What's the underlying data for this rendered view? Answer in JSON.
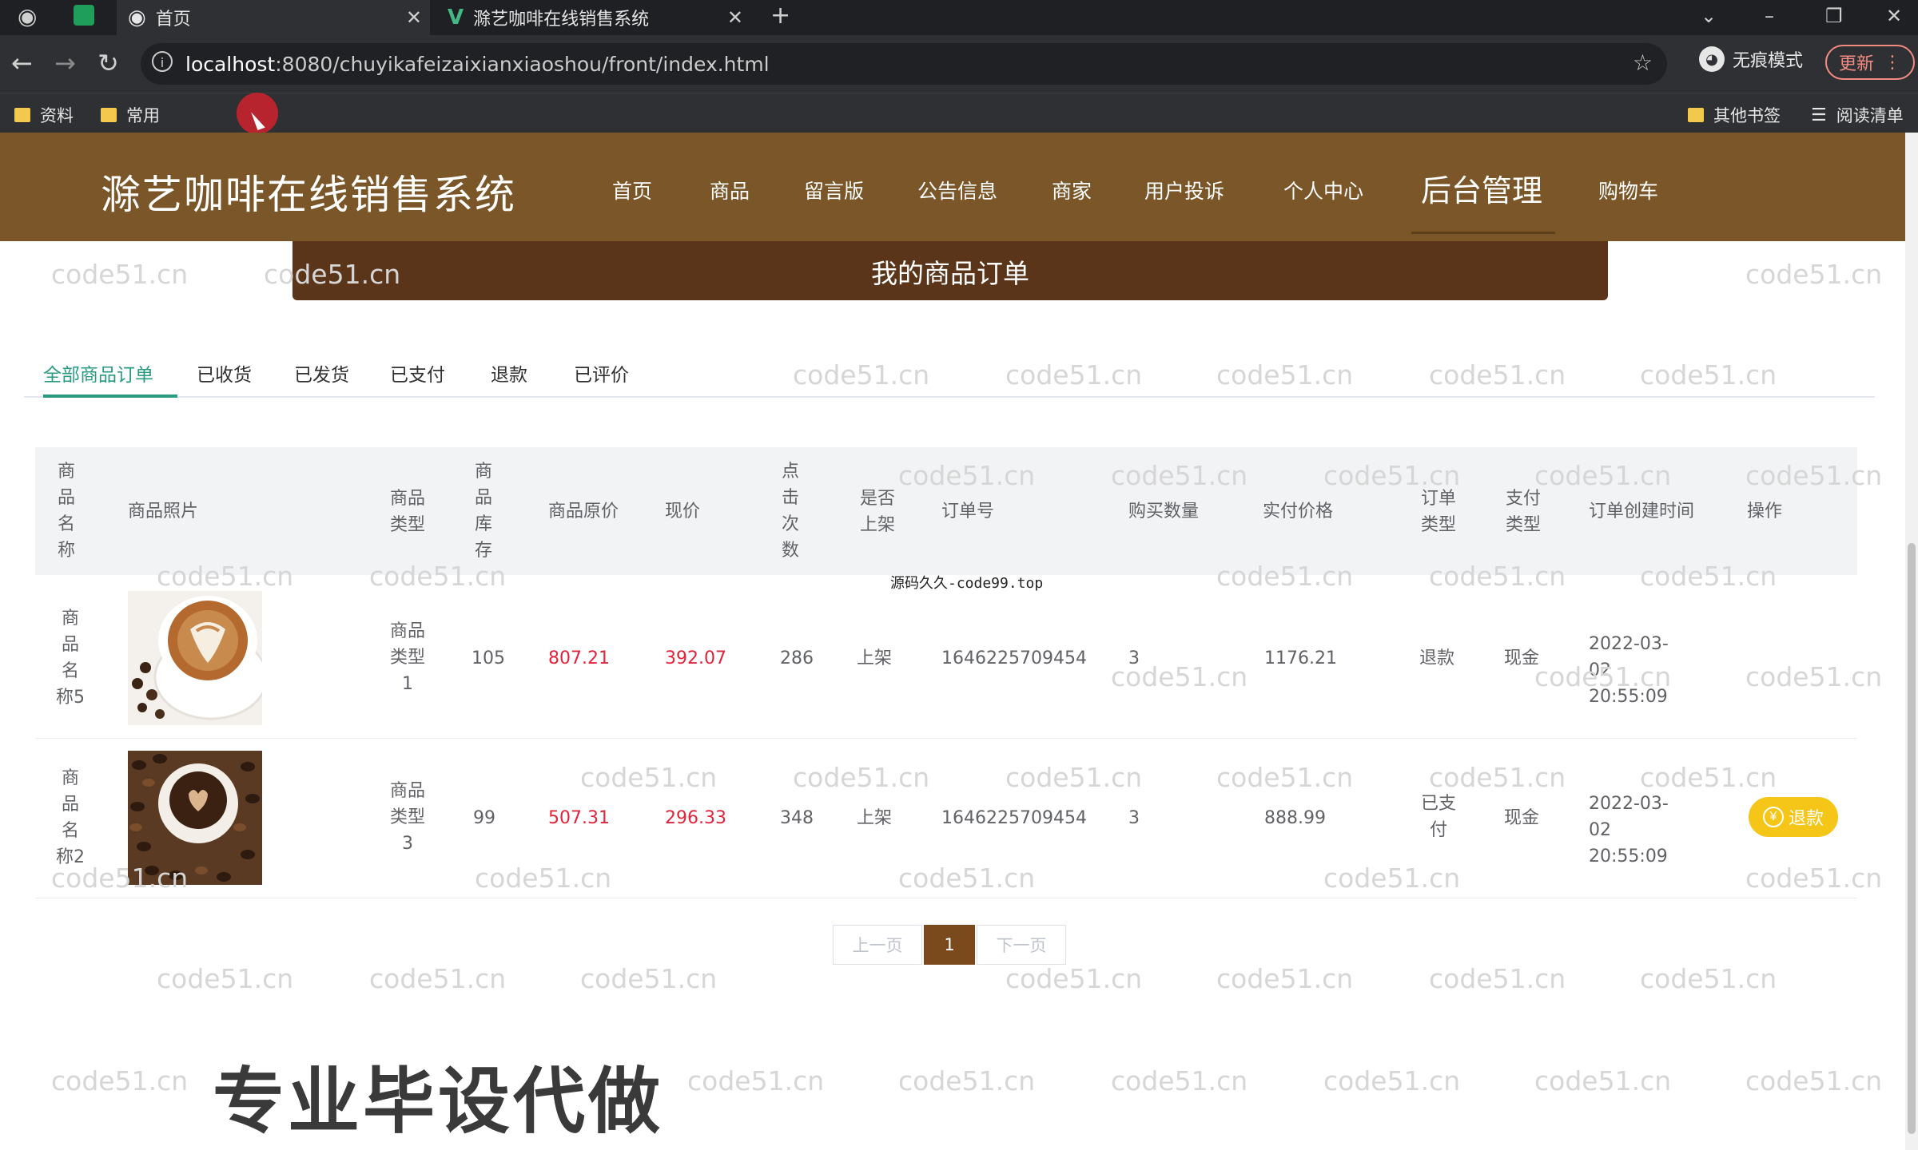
{
  "browser": {
    "tabs": [
      {
        "title": "首页"
      },
      {
        "title": "滁艺咖啡在线销售系统"
      }
    ],
    "url_host": "localhost",
    "url_rest": ":8080/chuyikafeizaixianxiaoshou/front/index.html",
    "incognito_label": "无痕模式",
    "update_label": "更新",
    "bookmarks": [
      "资料",
      "常用"
    ],
    "other_bookmarks": "其他书签",
    "reading_list": "阅读清单"
  },
  "site": {
    "title": "滁艺咖啡在线销售系统",
    "nav": [
      "首页",
      "商品",
      "留言版",
      "公告信息",
      "商家",
      "用户投诉",
      "个人中心",
      "后台管理",
      "购物车"
    ]
  },
  "section_title": "我的商品订单",
  "order_tabs": [
    "全部商品订单",
    "已收货",
    "已发货",
    "已支付",
    "退款",
    "已评价"
  ],
  "table": {
    "headers": [
      "商品名称",
      "商品照片",
      "商品类型",
      "商品库存",
      "商品原价",
      "现价",
      "点击次数",
      "是否上架",
      "订单号",
      "购买数量",
      "实付价格",
      "订单类型",
      "支付类型",
      "订单创建时间",
      "操作"
    ],
    "rows": [
      {
        "name": "商品名称5",
        "category": "商品类型1",
        "stock": "105",
        "orig_price": "807.21",
        "price": "392.07",
        "clicks": "286",
        "on_sale": "上架",
        "order_no": "1646225709454",
        "qty": "3",
        "paid": "1176.21",
        "order_type": "退款",
        "pay_type": "现金",
        "created": "2022-03-02 20:55:09",
        "action": ""
      },
      {
        "name": "商品名称2",
        "category": "商品类型3",
        "stock": "99",
        "orig_price": "507.31",
        "price": "296.33",
        "clicks": "348",
        "on_sale": "上架",
        "order_no": "1646225709454",
        "qty": "3",
        "paid": "888.99",
        "order_type": "已支付",
        "pay_type": "现金",
        "created": "2022-03-02 20:55:09",
        "action": "退款"
      }
    ]
  },
  "pagination": {
    "prev": "上一页",
    "current": "1",
    "next": "下一页"
  },
  "watermark": "code51.cn",
  "source_note": "源码久久-code99.top",
  "overlay_caption": "专业毕设代做",
  "colors": {
    "header_brown": "#7a5628",
    "banner_brown": "#5a3519",
    "accent_teal": "#2a9a82",
    "price_red": "#e0243b",
    "button_yellow": "#f5c518"
  }
}
